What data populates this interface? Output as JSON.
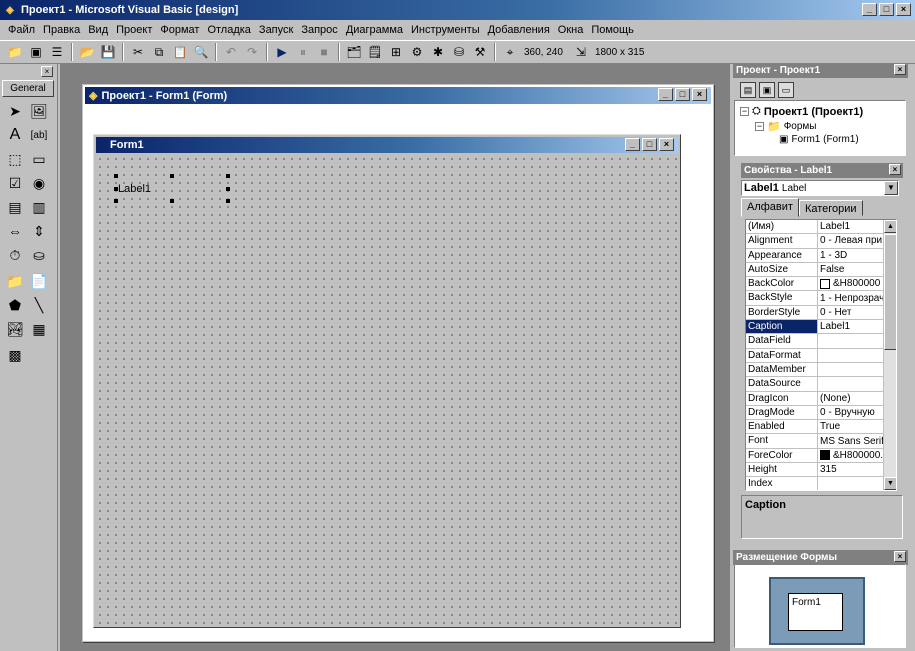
{
  "window": {
    "title": "Проект1 - Microsoft Visual Basic [design]",
    "min": "_",
    "max": "□",
    "close": "×"
  },
  "menu": [
    "Файл",
    "Правка",
    "Вид",
    "Проект",
    "Формат",
    "Отладка",
    "Запуск",
    "Запрос",
    "Диаграмма",
    "Инструменты",
    "Добавления",
    "Окна",
    "Помощь"
  ],
  "toolbar": {
    "position": "360, 240",
    "size": "1800 x 315"
  },
  "toolbox": {
    "tab": "General",
    "close": "×"
  },
  "project_window": {
    "title": "Проект1 - Form1 (Form)"
  },
  "form": {
    "title": "Form1",
    "label": "Label1"
  },
  "project_explorer": {
    "title": "Проект - Проект1",
    "root": "Проект1 (Проект1)",
    "folder": "Формы",
    "item": "Form1 (Form1)"
  },
  "properties": {
    "title": "Свойства - Label1",
    "object": "Label1",
    "object_type": "Label",
    "tab_alpha": "Алфавит",
    "tab_cat": "Категории",
    "rows": [
      {
        "name": "(Имя)",
        "value": "Label1"
      },
      {
        "name": "Alignment",
        "value": "0 - Левая при"
      },
      {
        "name": "Appearance",
        "value": "1 - 3D"
      },
      {
        "name": "AutoSize",
        "value": "False"
      },
      {
        "name": "BackColor",
        "value": "&H800000"
      },
      {
        "name": "BackStyle",
        "value": "1 - Непрозрач"
      },
      {
        "name": "BorderStyle",
        "value": "0 - Нет"
      },
      {
        "name": "Caption",
        "value": "Label1"
      },
      {
        "name": "DataField",
        "value": ""
      },
      {
        "name": "DataFormat",
        "value": ""
      },
      {
        "name": "DataMember",
        "value": ""
      },
      {
        "name": "DataSource",
        "value": ""
      },
      {
        "name": "DragIcon",
        "value": "(None)"
      },
      {
        "name": "DragMode",
        "value": "0 - Вручную"
      },
      {
        "name": "Enabled",
        "value": "True"
      },
      {
        "name": "Font",
        "value": "MS Sans Serif"
      },
      {
        "name": "ForeColor",
        "value": "&H800000."
      },
      {
        "name": "Height",
        "value": "315"
      },
      {
        "name": "Index",
        "value": ""
      }
    ],
    "description": "Caption",
    "colors": {
      "backcolor": "#ffffff",
      "forecolor": "#000000"
    }
  },
  "form_layout": {
    "title": "Размещение Формы",
    "form_label": "Form1"
  }
}
